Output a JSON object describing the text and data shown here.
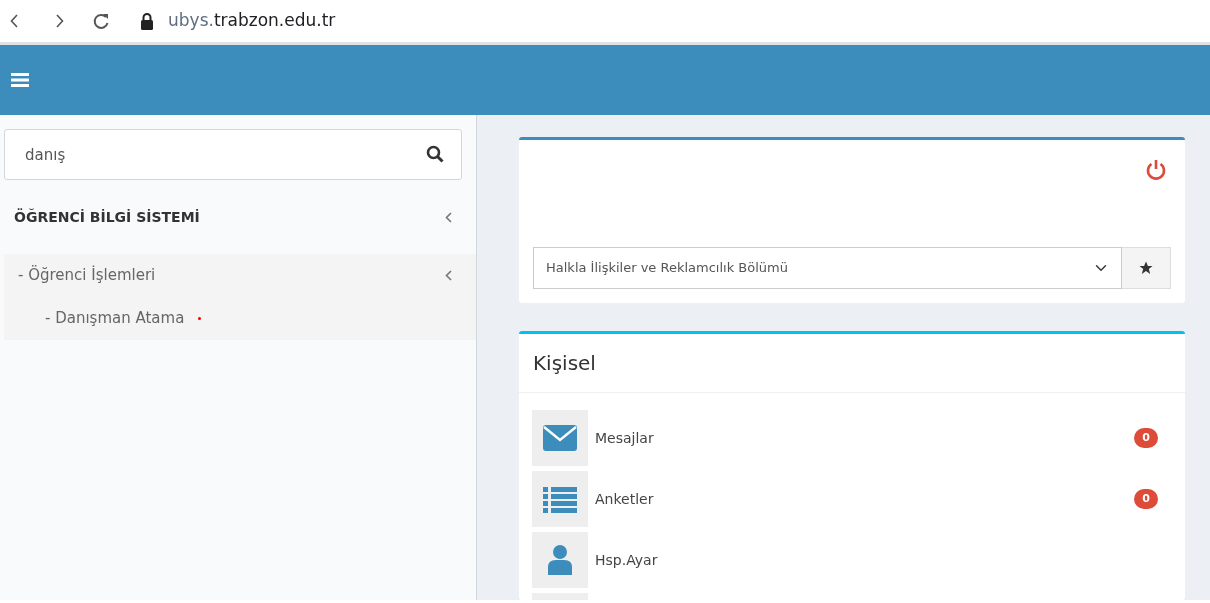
{
  "browser": {
    "url_host": "ubys.",
    "url_domain": "trabzon.edu.tr"
  },
  "sidebar": {
    "search": {
      "value": "danış"
    },
    "menu": [
      {
        "label": "ÖĞRENCİ BİLGİ SİSTEMİ",
        "children": [
          {
            "label": "- Öğrenci İşlemleri",
            "children": [
              {
                "label": "- Danışman Atama",
                "marked": true
              }
            ]
          }
        ]
      }
    ]
  },
  "unit_card": {
    "department": "Halkla İlişkiler ve Reklamcılık Bölümü"
  },
  "personal_card": {
    "title": "Kişisel",
    "items": [
      {
        "kind": "mail",
        "label": "Mesajlar",
        "count": "0"
      },
      {
        "kind": "list",
        "label": "Anketler",
        "count": "0"
      },
      {
        "kind": "user",
        "label": "Hsp.Ayar"
      },
      {
        "kind": "blank"
      }
    ]
  }
}
